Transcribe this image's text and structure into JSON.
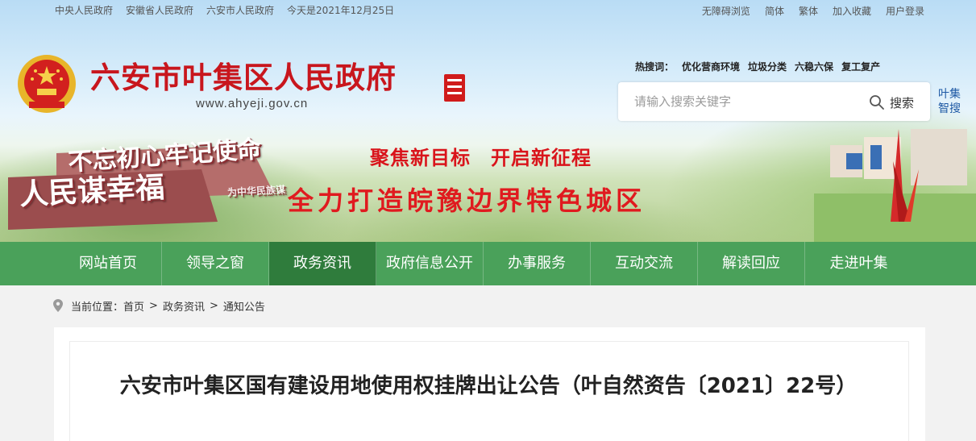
{
  "topbar": {
    "links": [
      "中央人民政府",
      "安徽省人民政府",
      "六安市人民政府"
    ],
    "date_text": "今天是2021年12月25日",
    "right_links": [
      "无障碍浏览",
      "简体",
      "繁体",
      "加入收藏",
      "用户登录"
    ]
  },
  "header": {
    "site_title": "六安市叶集区人民政府",
    "site_url": "www.ahyeji.gov.cn",
    "hotwords_label": "热搜词：",
    "hotwords": [
      "优化营商环境",
      "垃圾分类",
      "六稳六保",
      "复工复产"
    ],
    "search_placeholder": "请输入搜索关键字",
    "search_button": "搜索",
    "smart_search": "叶集智搜"
  },
  "banner": {
    "slogan_line1": "聚焦新目标　开启新征程",
    "slogan_line2": "全力打造皖豫边界特色城区",
    "monument_text1": "不忘初心牢记使命",
    "monument_text2": "人民谋幸福",
    "monument_text3": "为中华民族谋"
  },
  "nav": {
    "items": [
      "网站首页",
      "领导之窗",
      "政务资讯",
      "政府信息公开",
      "办事服务",
      "互动交流",
      "解读回应",
      "走进叶集"
    ],
    "active_index": 2
  },
  "breadcrumb": {
    "label": "当前位置：",
    "items": [
      "首页",
      "政务资讯",
      "通知公告"
    ],
    "separator": ">"
  },
  "article": {
    "title": "六安市叶集区国有建设用地使用权挂牌出让公告（叶自然资告〔2021〕22号）"
  },
  "colors": {
    "title_red": "#c8161d",
    "nav_green": "#4aa15a",
    "nav_active": "#2f7c3c"
  }
}
